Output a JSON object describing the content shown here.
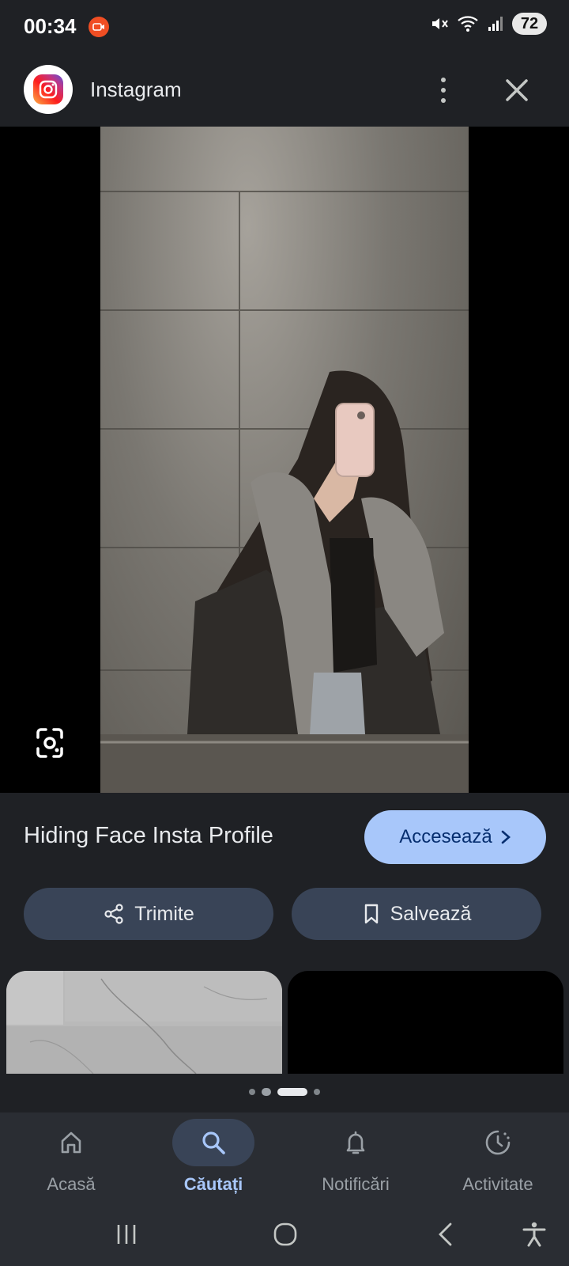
{
  "status_bar": {
    "time": "00:34",
    "battery": "72",
    "icons": [
      "screen-record-icon",
      "mute-icon",
      "wifi-icon",
      "signal-icon",
      "battery-icon"
    ]
  },
  "header": {
    "app_name": "Instagram",
    "icons": [
      "instagram-logo",
      "more-vert-icon",
      "close-icon"
    ]
  },
  "result": {
    "title": "Hiding Face Insta Profile",
    "visit_label": "Accesează"
  },
  "actions": {
    "share_label": "Trimite",
    "save_label": "Salvează"
  },
  "pager": {
    "count": 4,
    "active_index": 2
  },
  "bottom_nav": {
    "active": "Căutați",
    "items": [
      {
        "label": "Acasă",
        "icon": "home-icon"
      },
      {
        "label": "Căutați",
        "icon": "search-icon"
      },
      {
        "label": "Notificări",
        "icon": "bell-icon"
      },
      {
        "label": "Activitate",
        "icon": "activity-icon"
      }
    ]
  },
  "colors": {
    "background": "#1f2125",
    "accent": "#a8c7fa",
    "pill": "#394457"
  }
}
